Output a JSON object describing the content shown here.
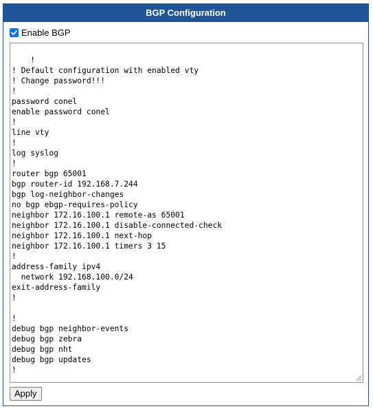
{
  "panel": {
    "title": "BGP Configuration"
  },
  "enable": {
    "label": "Enable BGP",
    "checked": true
  },
  "config": {
    "text": "!\n! Default configuration with enabled vty\n! Change password!!!\n!\npassword conel\nenable password conel\n!\nline vty\n!\nlog syslog\n!\nrouter bgp 65001\nbgp router-id 192.168.7.244\nbgp log-neighbor-changes\nno bgp ebgp-requires-policy\nneighbor 172.16.100.1 remote-as 65001\nneighbor 172.16.100.1 disable-connected-check\nneighbor 172.16.100.1 next-hop\nneighbor 172.16.100.1 timers 3 15\n!\naddress-family ipv4\n  network 192.168.100.0/24\nexit-address-family\n!\n\n!\ndebug bgp neighbor-events\ndebug bgp zebra\ndebug bgp nht\ndebug bgp updates\n!"
  },
  "actions": {
    "apply_label": "Apply"
  },
  "colors": {
    "header_bg": "#1f5596",
    "checkbox": "#0b75e0"
  },
  "icons": {
    "checkbox": "checkmark-icon",
    "grip": "resize-grip-icon"
  }
}
